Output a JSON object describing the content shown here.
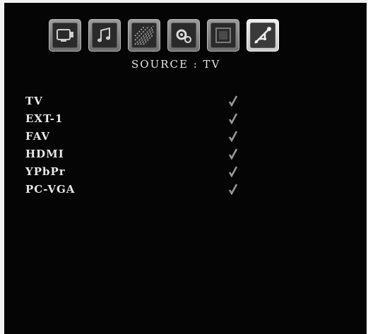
{
  "toolbar": {
    "icons": [
      "picture-icon",
      "sound-icon",
      "settings-icon",
      "features-icon",
      "install-icon",
      "source-icon"
    ],
    "active_index": 5
  },
  "header": {
    "title": "SOURCE : TV"
  },
  "sources": [
    {
      "label": "TV",
      "enabled": true
    },
    {
      "label": "EXT-1",
      "enabled": true
    },
    {
      "label": "FAV",
      "enabled": true
    },
    {
      "label": "HDMI",
      "enabled": true
    },
    {
      "label": "YPbPr",
      "enabled": true
    },
    {
      "label": "PC-VGA",
      "enabled": true
    }
  ],
  "colors": {
    "background": "#050505",
    "text": "#e8e8e8",
    "check": "#9a9a9a"
  }
}
